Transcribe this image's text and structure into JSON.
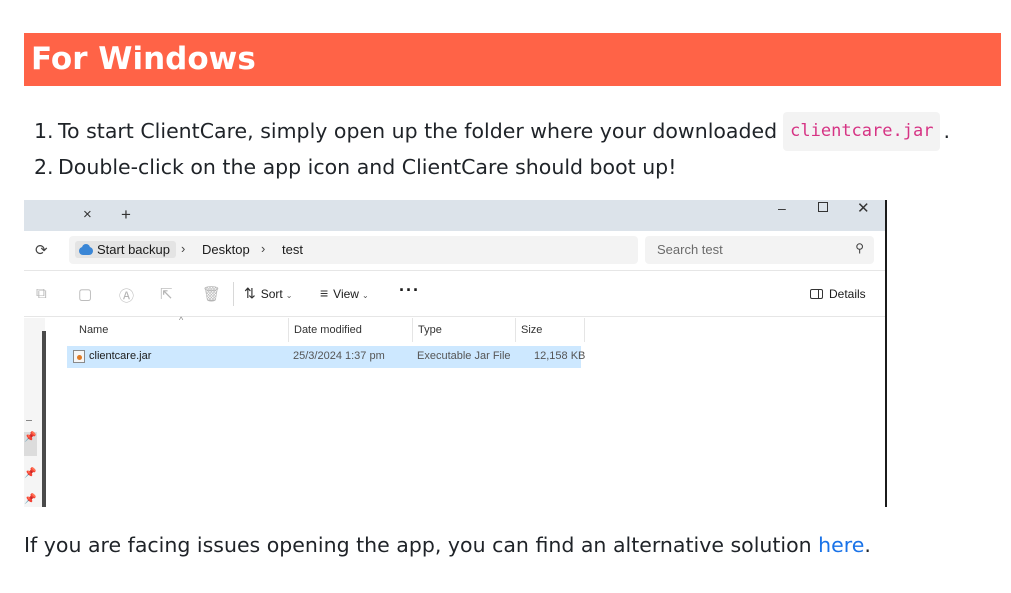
{
  "heading": "For Windows",
  "steps": [
    {
      "number": "1.",
      "text_before": "To start ClientCare, simply open up the folder where your downloaded",
      "code": "clientcare.jar",
      "text_after": "."
    },
    {
      "number": "2.",
      "text": "Double-click on the app icon and ClientCare should boot up!"
    }
  ],
  "explorer": {
    "tab_close": "×",
    "tab_new": "+",
    "window_controls": {
      "minimize": "–",
      "close": "✕"
    },
    "breadcrumb": [
      "Start backup",
      "Desktop",
      "test"
    ],
    "breadcrumb_separator": "›",
    "search_placeholder": "Search test",
    "commands": {
      "sort": "Sort",
      "view": "View",
      "more": "···",
      "details": "Details"
    },
    "columns": [
      "Name",
      "Date modified",
      "Type",
      "Size"
    ],
    "files": [
      {
        "name": "clientcare.jar",
        "date_modified": "25/3/2024 1:37 pm",
        "type": "Executable Jar File",
        "size": "12,158 KB"
      }
    ],
    "selected_color": "#cde8ff"
  },
  "footer": {
    "text": "If you are facing issues opening the app, you can find an alternative solution ",
    "link": "here",
    "end": "."
  },
  "colors": {
    "banner": "#ff6347",
    "code": "#d63384",
    "link": "#1a73e8"
  }
}
